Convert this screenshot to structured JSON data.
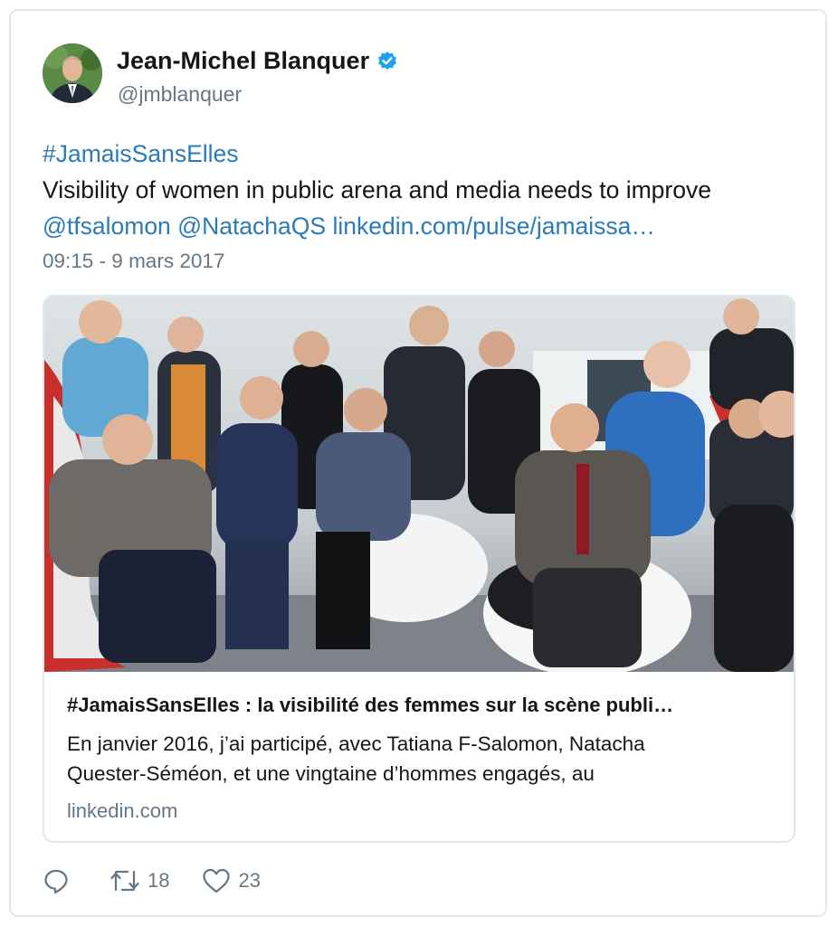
{
  "author": {
    "name": "Jean-Michel Blanquer",
    "handle": "@jmblanquer"
  },
  "tweet": {
    "hashtag": "#JamaisSansElles",
    "text": "Visibility of women in public arena and media needs to improve",
    "mention1": "@tfsalomon",
    "mention2": "@NatachaQS",
    "url": "linkedin.com/pulse/jamaissa…",
    "timestamp": "09:15 - 9 mars 2017"
  },
  "card": {
    "title": "#JamaisSansElles : la visibilité des femmes sur la scène publi…",
    "desc_line1": "En janvier 2016, j’ai participé, avec Tatiana F-Salomon, Natacha",
    "desc_line2": "Quester-Séméon, et une vingtaine d’hommes engagés, au",
    "domain": "linkedin.com"
  },
  "actions": {
    "reply_count": "",
    "retweet_count": "18",
    "like_count": "23"
  },
  "colors": {
    "link": "#2b7bb9",
    "muted": "#657786",
    "text": "#14171a",
    "border": "#e1e8ed",
    "verified": "#1da1f2"
  },
  "icons": [
    "verified-badge-icon",
    "reply-icon",
    "retweet-icon",
    "like-icon"
  ]
}
